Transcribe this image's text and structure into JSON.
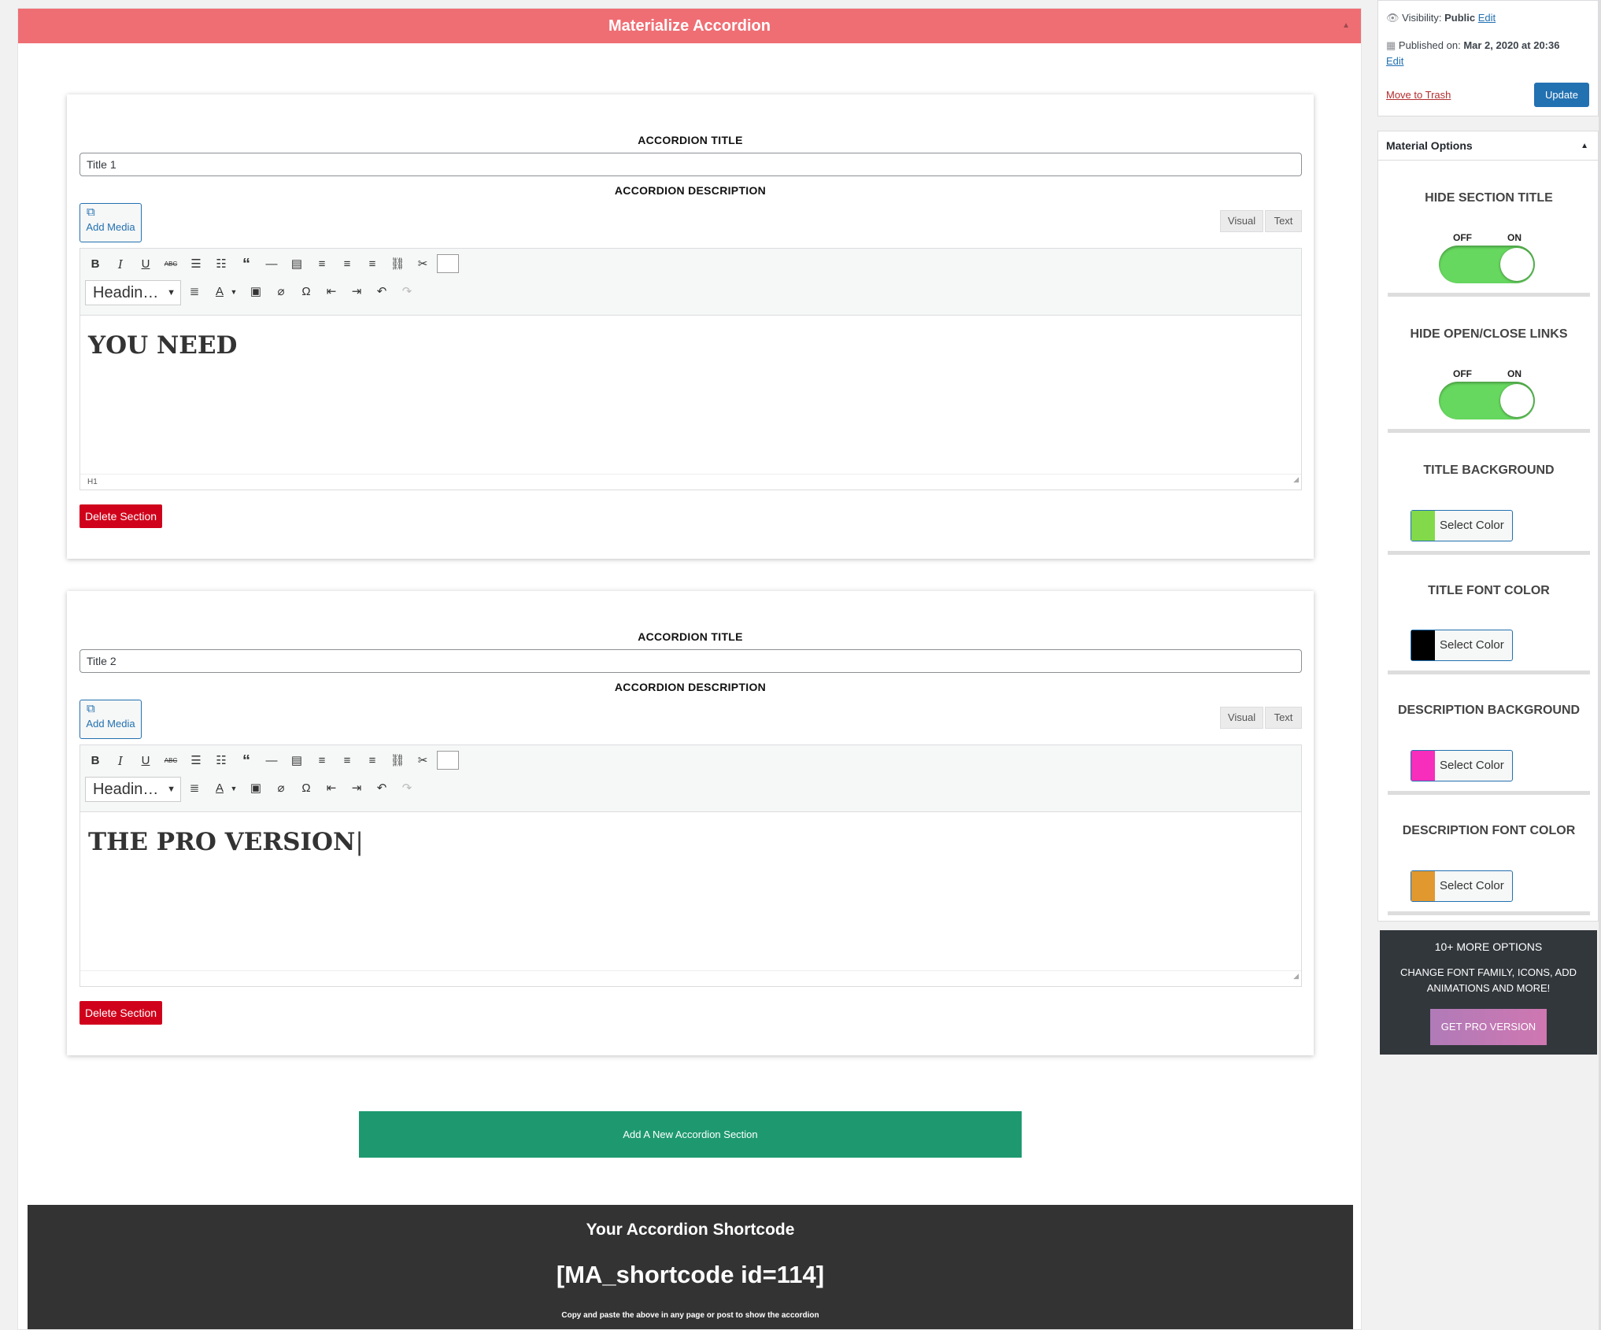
{
  "metabox": {
    "title": "Materialize Accordion",
    "toggle_icon": "▲"
  },
  "sections": [
    {
      "title_label": "ACCORDION TITLE",
      "title_value": "Title 1",
      "description_label": "ACCORDION DESCRIPTION",
      "add_media": "Add Media",
      "tab_visual": "Visual",
      "tab_text": "Text",
      "format_select": "Headin…",
      "content": "YOU NEED",
      "status_path": "H1",
      "delete": "Delete Section"
    },
    {
      "title_label": "ACCORDION TITLE",
      "title_value": "Title 2",
      "description_label": "ACCORDION DESCRIPTION",
      "add_media": "Add Media",
      "tab_visual": "Visual",
      "tab_text": "Text",
      "format_select": "Headin…",
      "content": "THE PRO VERSION",
      "status_path": "",
      "delete": "Delete Section"
    }
  ],
  "add_section_button": "Add A New Accordion Section",
  "shortcode": {
    "heading": "Your Accordion Shortcode",
    "code": "[MA_shortcode id=114]",
    "note": "Copy and paste the above in any page or post to show the accordion"
  },
  "publish": {
    "visibility_label": "Visibility:",
    "visibility_value": "Public",
    "visibility_edit": "Edit",
    "published_label": "Published on:",
    "published_value": "Mar 2, 2020 at 20:36",
    "published_edit": "Edit",
    "trash": "Move to Trash",
    "update": "Update"
  },
  "options": {
    "header": "Material Options",
    "toggle_icon": "▲",
    "hide_section_title": {
      "label": "HIDE SECTION TITLE",
      "off": "OFF",
      "on": "ON",
      "state": "on"
    },
    "hide_open_close": {
      "label": "HIDE OPEN/CLOSE LINKS",
      "off": "OFF",
      "on": "ON",
      "state": "on"
    },
    "title_background": {
      "label": "TITLE BACKGROUND",
      "button": "Select Color",
      "color": "#82d94a"
    },
    "title_font_color": {
      "label": "TITLE FONT COLOR",
      "button": "Select Color",
      "color": "#000000"
    },
    "description_background": {
      "label": "DESCRIPTION BACKGROUND",
      "button": "Select Color",
      "color": "#f72dbc"
    },
    "description_font_color": {
      "label": "DESCRIPTION FONT COLOR",
      "button": "Select Color",
      "color": "#e0982f"
    }
  },
  "pro": {
    "line1": "10+ MORE OPTIONS",
    "line2": "CHANGE FONT FAMILY, ICONS, ADD ANIMATIONS AND MORE!",
    "button": "GET PRO VERSION"
  },
  "colors": {
    "header_red": "#ef6e74",
    "add_green": "#1e996f",
    "delete_red": "#d0021b",
    "wp_blue": "#2271b1",
    "switch_green": "#67d85f"
  }
}
